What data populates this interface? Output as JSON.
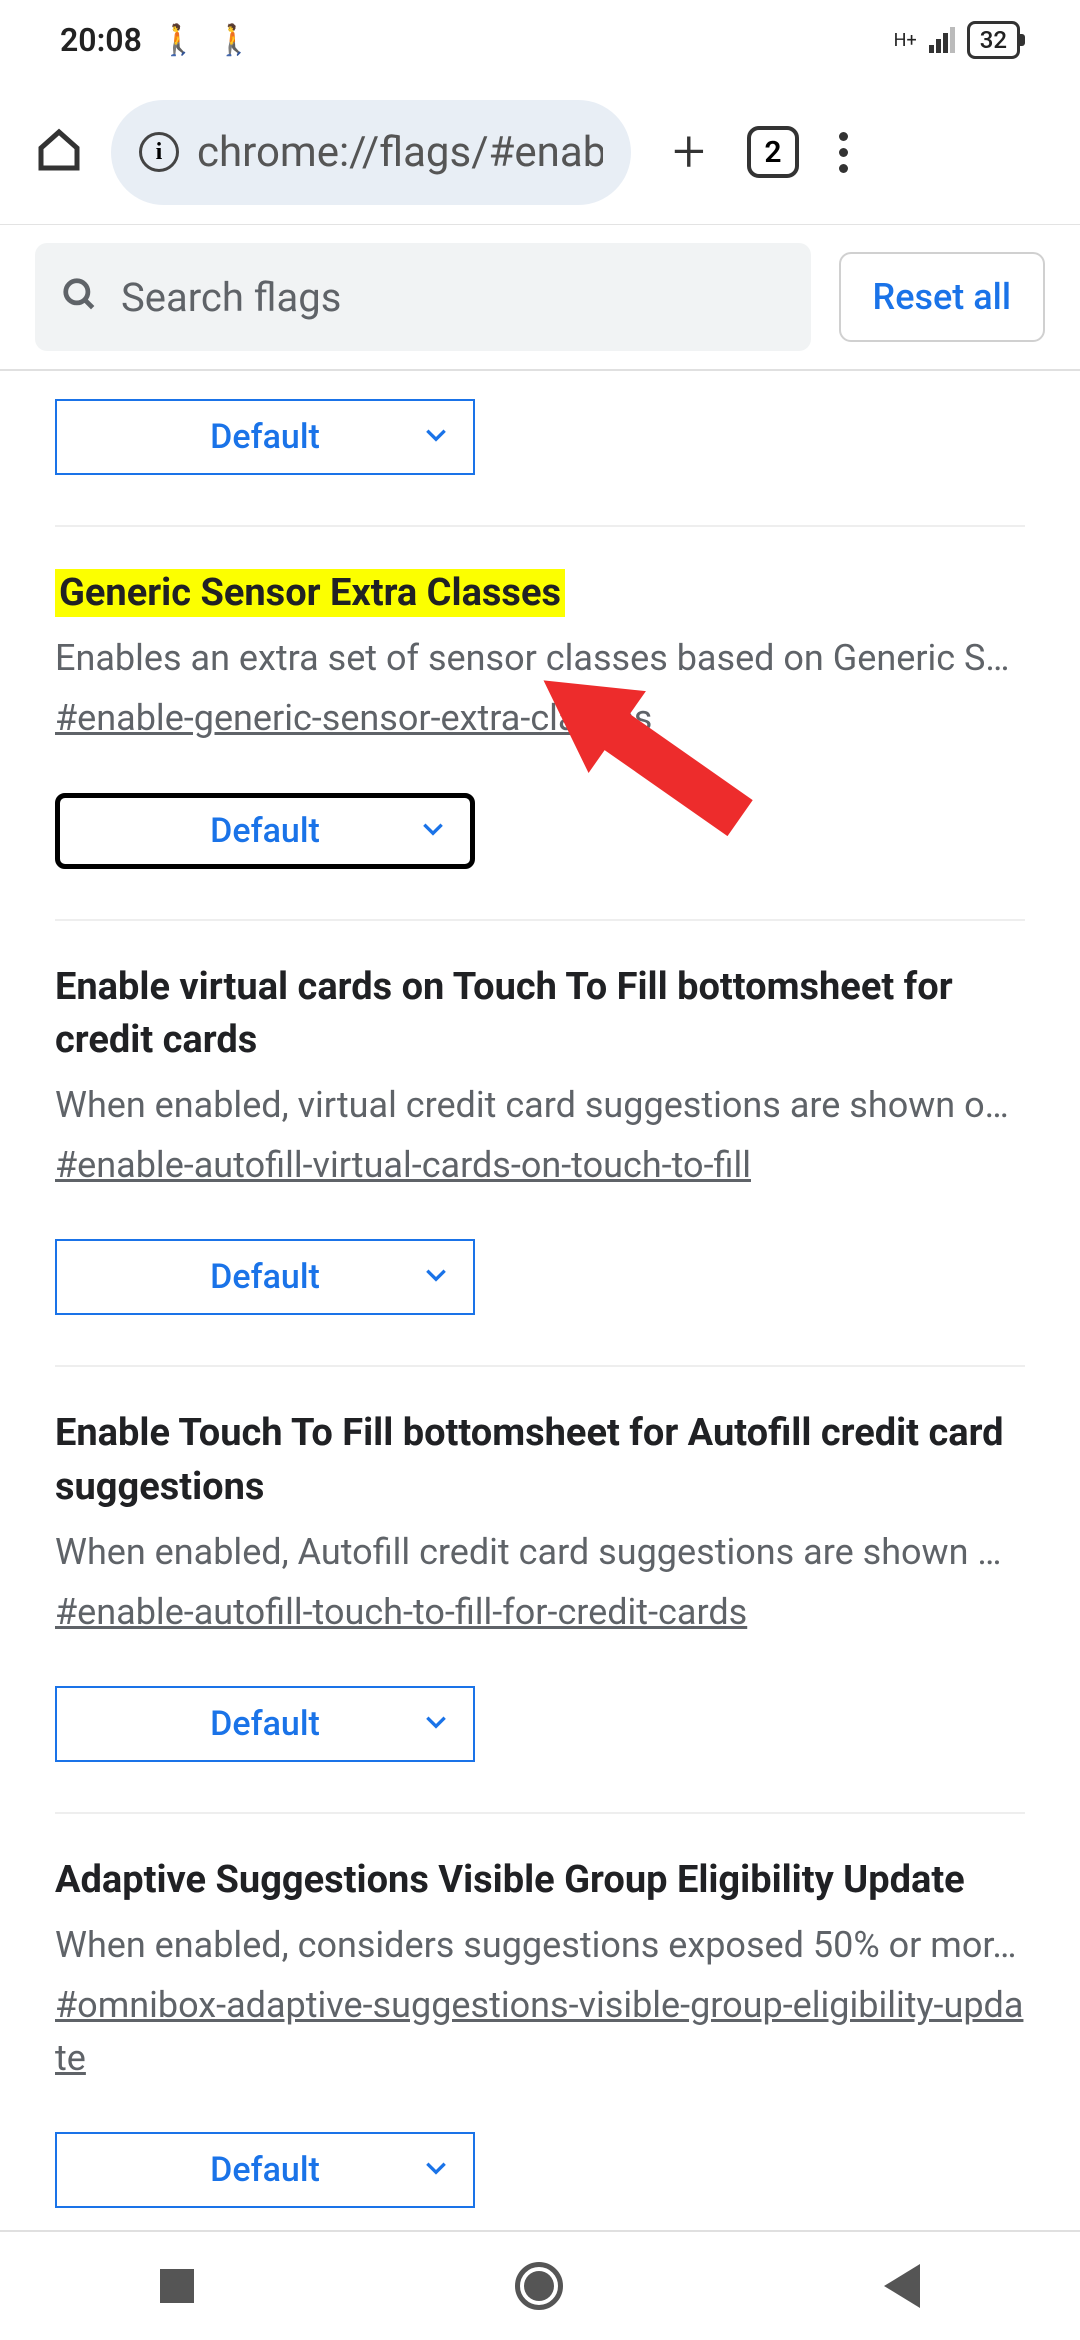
{
  "status": {
    "time": "20:08",
    "battery": "32"
  },
  "browser": {
    "url": "chrome://flags/#enab",
    "tab_count": "2"
  },
  "search": {
    "placeholder": "Search flags",
    "reset_label": "Reset all"
  },
  "flags": {
    "orphan_dropdown": "Default",
    "items": [
      {
        "title": "Generic Sensor Extra Classes",
        "desc": "Enables an extra set of sensor classes based on Generic S…",
        "hash": "#enable-generic-sensor-extra-classes",
        "dropdown": "Default",
        "highlighted": true,
        "focused": true
      },
      {
        "title": "Enable virtual cards on Touch To Fill bottomsheet for credit cards",
        "desc": "When enabled, virtual credit card suggestions are shown o…",
        "hash": "#enable-autofill-virtual-cards-on-touch-to-fill",
        "dropdown": "Default"
      },
      {
        "title": "Enable Touch To Fill bottomsheet for Autofill credit card suggestions",
        "desc": "When enabled, Autofill credit card suggestions are shown …",
        "hash": "#enable-autofill-touch-to-fill-for-credit-cards",
        "dropdown": "Default"
      },
      {
        "title": "Adaptive Suggestions Visible Group Eligibility Update",
        "desc": "When enabled, considers suggestions exposed 50% or mor…",
        "hash": "#omnibox-adaptive-suggestions-visible-group-eligibility-update",
        "dropdown": "Default"
      }
    ]
  }
}
